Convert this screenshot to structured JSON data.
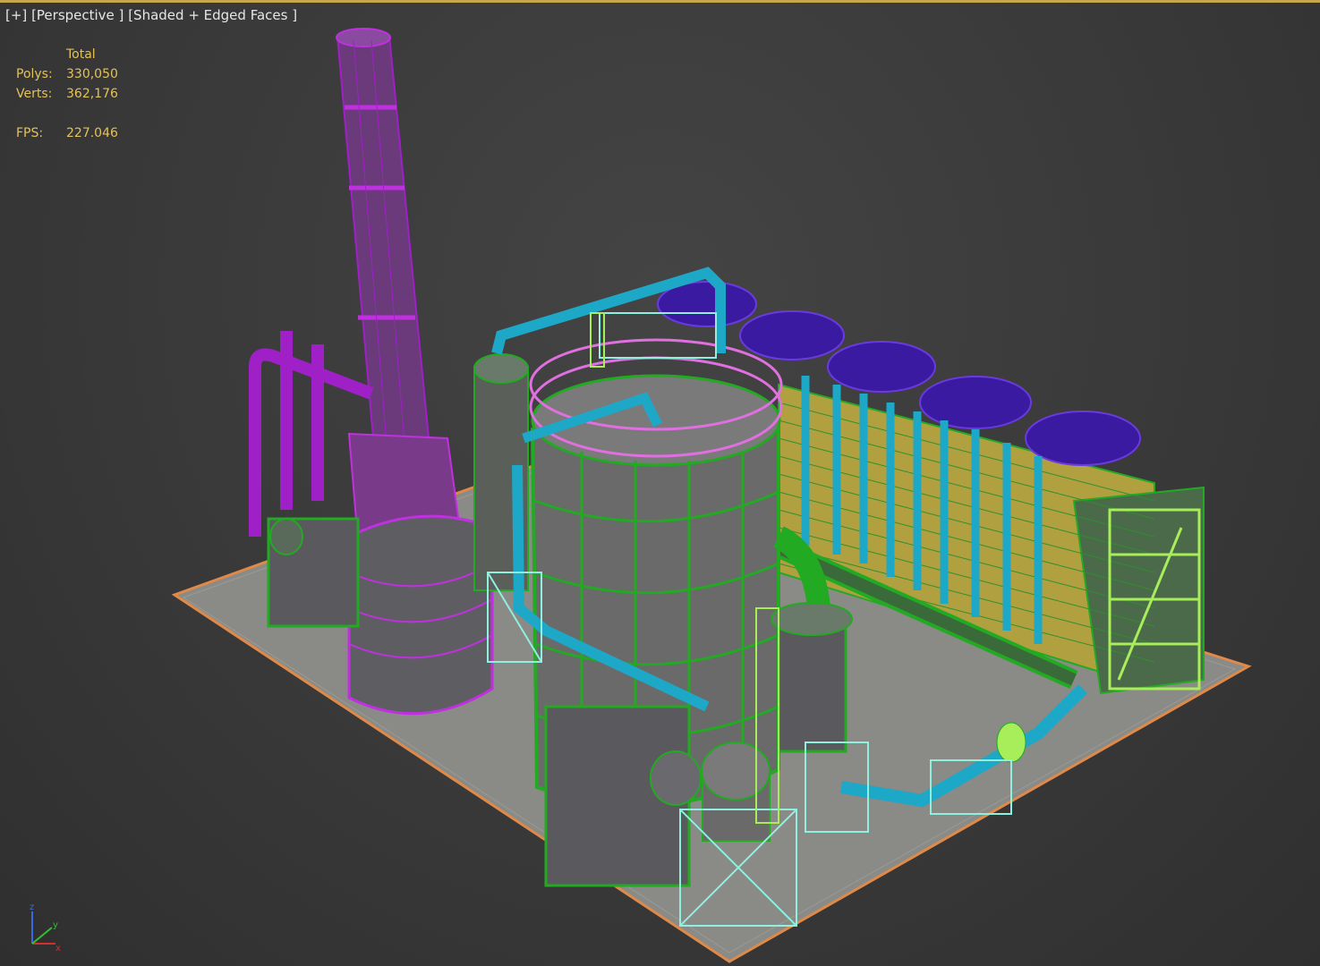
{
  "viewport": {
    "label_plus": "[+]",
    "label_view": "[Perspective ]",
    "label_shading": "[Shaded + Edged Faces ]"
  },
  "stats": {
    "header": "Total",
    "polys_label": "Polys:",
    "polys_value": "330,050",
    "verts_label": "Verts:",
    "verts_value": "362,176",
    "fps_label": "FPS:",
    "fps_value": "227.046"
  },
  "gizmo": {
    "z_label": "z",
    "x_label": "x",
    "y_label": "y"
  },
  "colors": {
    "background": "#3a3a3a",
    "stats_text": "#e3c25a",
    "purple": "#a020c8",
    "cyan": "#1ea8c8",
    "green": "#22aa22",
    "lime": "#a8ee5a",
    "aqua": "#8ff0e0",
    "violet": "#5a2ad0",
    "pink": "#e070e0",
    "ground_edge": "#e08a4a"
  }
}
